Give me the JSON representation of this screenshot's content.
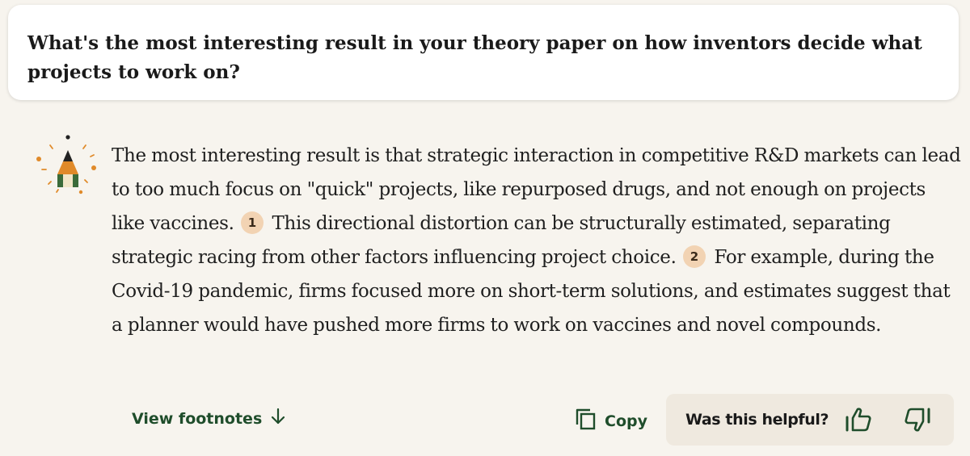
{
  "question": {
    "text": "What's the most interesting result in your theory paper on how inventors decide what projects to work on?"
  },
  "answer": {
    "part1": "The most interesting result is that strategic interaction in competitive R&D markets can lead to too much focus on \"quick\" projects, like repurposed drugs, and not enough on projects like vaccines.",
    "citation1": "1",
    "part2": "This directional distortion can be structurally estimated, separating strategic racing from other factors influencing project choice.",
    "citation2": "2",
    "part3": "For example, during the Covid-19 pandemic, firms focused more on short-term solutions, and estimates suggest that a planner would have pushed more firms to work on vaccines and novel compounds."
  },
  "footer": {
    "view_footnotes_label": "View footnotes",
    "copy_label": "Copy",
    "helpful_label": "Was this helpful?"
  },
  "icons": {
    "assistant": "pencil-avatar-icon",
    "footnotes": "arrow-down-icon",
    "copy": "copy-icon",
    "thumbs_up": "thumbs-up-icon",
    "thumbs_down": "thumbs-down-icon"
  },
  "colors": {
    "background": "#f7f4ee",
    "accent_green": "#1f4d2b",
    "citation_badge": "#f2d3b3",
    "feedback_bg": "#efe9df",
    "pencil_orange": "#e08a2a"
  }
}
